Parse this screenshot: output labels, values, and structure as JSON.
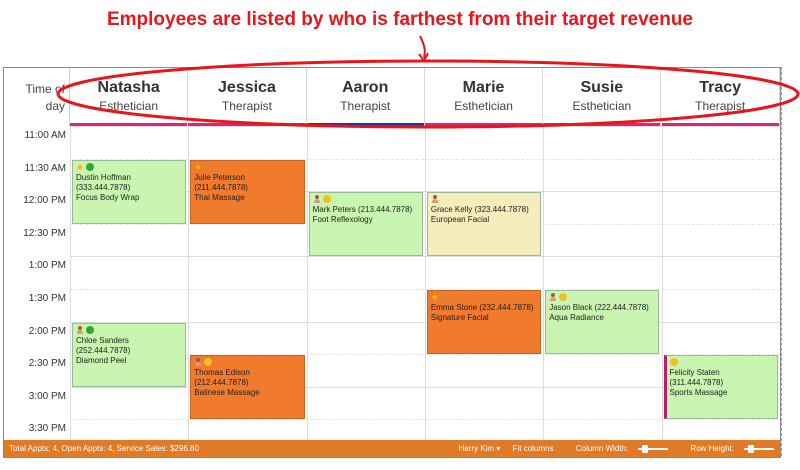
{
  "annotation": {
    "text": "Employees are listed by who is farthest from their target revenue",
    "color": "#e8151b"
  },
  "header": {
    "time_of_day_line1": "Time of",
    "time_of_day_line2": "day"
  },
  "employees": [
    {
      "name": "Natasha",
      "role": "Esthetician",
      "bar_color": "#e0207a"
    },
    {
      "name": "Jessica",
      "role": "Therapist",
      "bar_color": "#e0207a"
    },
    {
      "name": "Aaron",
      "role": "Therapist",
      "bar_color": "#2233aa"
    },
    {
      "name": "Marie",
      "role": "Esthetician",
      "bar_color": "#e0207a"
    },
    {
      "name": "Susie",
      "role": "Esthetician",
      "bar_color": "#e0207a"
    },
    {
      "name": "Tracy",
      "role": "Therapist",
      "bar_color": "#e0207a"
    }
  ],
  "times": [
    "11:00 AM",
    "11:30 AM",
    "12:00 PM",
    "12:30 PM",
    "1:00 PM",
    "1:30 PM",
    "2:00 PM",
    "2:30 PM",
    "3:00 PM",
    "3:30 PM"
  ],
  "appointments": [
    {
      "client": "Dustin Hoffman (333.444.7878)",
      "service": "Focus Body Wrap",
      "employee": "Natasha",
      "start": "11:30 AM",
      "end": "12:30 PM",
      "color": "#c9f5b0",
      "icons": [
        "star-icon",
        "green-circle-icon"
      ]
    },
    {
      "client": "Julie Peterson (211.444.7878)",
      "service": "Thai Massage",
      "employee": "Jessica",
      "start": "11:30 AM",
      "end": "12:30 PM",
      "color": "#f07b2c",
      "icons": [
        "star-icon"
      ]
    },
    {
      "client": "Mark Peters (213.444.7878)",
      "service": "Foot Reflexology",
      "employee": "Aaron",
      "start": "12:00 PM",
      "end": "1:00 PM",
      "color": "#c9f5b0",
      "icons": [
        "person-icon",
        "yellow-circle-icon"
      ]
    },
    {
      "client": "Grace Kelly (323.444.7878)",
      "service": "European Facial",
      "employee": "Marie",
      "start": "12:00 PM",
      "end": "1:00 PM",
      "color": "#f5edbc",
      "icons": [
        "person-icon"
      ]
    },
    {
      "client": "Emma Stone (232.444.7878)",
      "service": "Signature Facial",
      "employee": "Marie",
      "start": "1:30 PM",
      "end": "2:30 PM",
      "color": "#f07b2c",
      "icons": [
        "star-icon"
      ]
    },
    {
      "client": "Jason Black (222.444.7878)",
      "service": "Aqua Radiance",
      "employee": "Susie",
      "start": "1:30 PM",
      "end": "2:30 PM",
      "color": "#c9f5b0",
      "icons": [
        "person-icon",
        "yellow-circle-icon"
      ]
    },
    {
      "client": "Chloe Sanders (252.444.7878)",
      "service": "Diamond Peel",
      "employee": "Natasha",
      "start": "2:00 PM",
      "end": "3:00 PM",
      "color": "#c9f5b0",
      "icons": [
        "person-icon",
        "green-circle-icon"
      ]
    },
    {
      "client": "Thomas Edison (212.444.7878)",
      "service": "Balinese Massage",
      "employee": "Jessica",
      "start": "2:30 PM",
      "end": "3:30 PM",
      "color": "#f07b2c",
      "icons": [
        "person-icon",
        "yellow-circle-icon"
      ]
    },
    {
      "client": "Felicity Staten (311.444.7878)",
      "service": "Sports Massage",
      "employee": "Tracy",
      "start": "2:30 PM",
      "end": "3:30 PM",
      "color": "#c9f5b0",
      "icons": [
        "yellow-circle-icon"
      ],
      "accent": "#c0186a"
    }
  ],
  "status": {
    "summary": "Total Appts: 4, Open Appts: 4, Service Sales: $296.80",
    "user": "Harry Kim",
    "fit_columns": "Fit columns",
    "column_width": "Column Width:",
    "row_height": "Row Height:",
    "bar_color": "#e07a26"
  }
}
